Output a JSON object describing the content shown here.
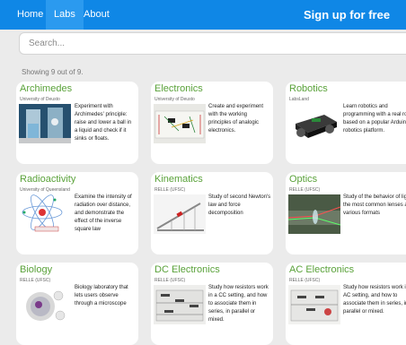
{
  "nav": {
    "home": "Home",
    "labs": "Labs",
    "about": "About",
    "signup": "Sign up for free"
  },
  "search": {
    "placeholder": "Search..."
  },
  "results": {
    "count_text": "Showing 9 out of 9."
  },
  "labs": [
    {
      "title": "Archimedes",
      "org": "University of Deusto",
      "desc": "Experiment with Archimedes' principle: raise and lower a ball in a liquid and check if it sinks or floats."
    },
    {
      "title": "Electronics",
      "org": "University of Deusto",
      "desc": "Create and experiment with the working principles of analogic electronics."
    },
    {
      "title": "Robotics",
      "org": "LabsLand",
      "desc": "Learn robotics and programming with a real robot based on a popular Arduino robotics platform."
    },
    {
      "title": "Radioactivity",
      "org": "University of Queensland",
      "desc": "Examine the intensity of radiation over distance, and demonstrate the effect of the inverse square law"
    },
    {
      "title": "Kinematics",
      "org": "RELLE (UFSC)",
      "desc": "Study of second Newton's law and force decomposition"
    },
    {
      "title": "Optics",
      "org": "RELLE (UFSC)",
      "desc": "Study of the behavior of light in the most common lenses and various formats"
    },
    {
      "title": "Biology",
      "org": "RELLE (UFSC)",
      "desc": "Biology laboratory that lets users observe through a microscope"
    },
    {
      "title": "DC Electronics",
      "org": "RELLE (UFSC)",
      "desc": "Study how resistors work in a CC setting, and how to associate them in series, in parallel or mixed."
    },
    {
      "title": "AC Electronics",
      "org": "RELLE (UFSC)",
      "desc": "Study how resistors work in an AC setting, and how to associate them in series, in parallel or mixed."
    }
  ]
}
